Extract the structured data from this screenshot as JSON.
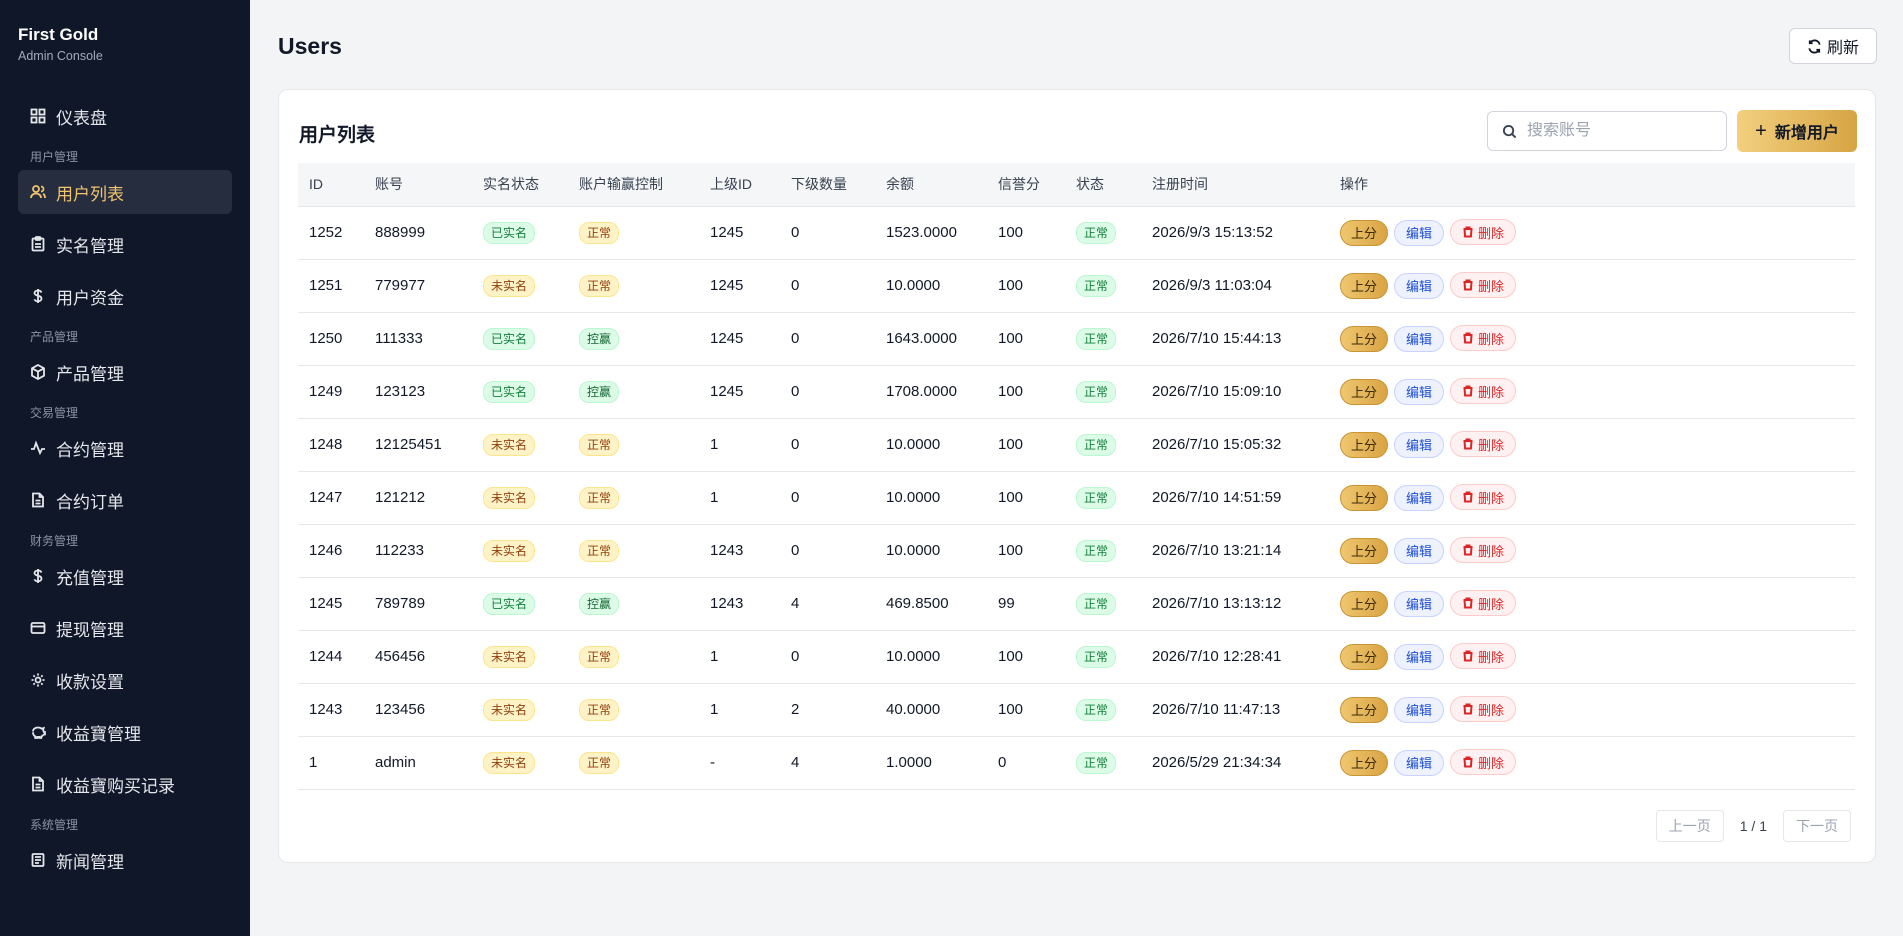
{
  "brand": {
    "title": "First Gold",
    "subtitle": "Admin Console"
  },
  "sidebar": {
    "dashboard": "仪表盘",
    "sec_user": "用户管理",
    "users": "用户列表",
    "realname": "实名管理",
    "funds": "用户资金",
    "sec_product": "产品管理",
    "products": "产品管理",
    "sec_trade": "交易管理",
    "contracts": "合约管理",
    "orders": "合约订单",
    "sec_finance": "财务管理",
    "recharge": "充值管理",
    "withdraw": "提现管理",
    "payment": "收款设置",
    "yield": "收益寶管理",
    "yield_records": "收益寶购买记录",
    "sec_system": "系统管理",
    "news": "新闻管理"
  },
  "header": {
    "title": "Users",
    "refresh": "刷新"
  },
  "card": {
    "title": "用户列表",
    "search_placeholder": "搜索账号",
    "add_label": "新增用户"
  },
  "table": {
    "columns": [
      "ID",
      "账号",
      "实名状态",
      "账户输赢控制",
      "上级ID",
      "下级数量",
      "余额",
      "信誉分",
      "状态",
      "注册时间",
      "操作"
    ],
    "actions": {
      "up": "上分",
      "edit": "编辑",
      "delete": "删除"
    },
    "rows": [
      {
        "id": "1252",
        "account": "888999",
        "realname": "已实名",
        "control": "正常",
        "parent": "1245",
        "children": "0",
        "balance": "1523.0000",
        "credit": "100",
        "status": "正常",
        "registered": "2026/9/3 15:13:52"
      },
      {
        "id": "1251",
        "account": "779977",
        "realname": "未实名",
        "control": "正常",
        "parent": "1245",
        "children": "0",
        "balance": "10.0000",
        "credit": "100",
        "status": "正常",
        "registered": "2026/9/3 11:03:04"
      },
      {
        "id": "1250",
        "account": "111333",
        "realname": "已实名",
        "control": "控赢",
        "parent": "1245",
        "children": "0",
        "balance": "1643.0000",
        "credit": "100",
        "status": "正常",
        "registered": "2026/7/10 15:44:13"
      },
      {
        "id": "1249",
        "account": "123123",
        "realname": "已实名",
        "control": "控赢",
        "parent": "1245",
        "children": "0",
        "balance": "1708.0000",
        "credit": "100",
        "status": "正常",
        "registered": "2026/7/10 15:09:10"
      },
      {
        "id": "1248",
        "account": "12125451",
        "realname": "未实名",
        "control": "正常",
        "parent": "1",
        "children": "0",
        "balance": "10.0000",
        "credit": "100",
        "status": "正常",
        "registered": "2026/7/10 15:05:32"
      },
      {
        "id": "1247",
        "account": "121212",
        "realname": "未实名",
        "control": "正常",
        "parent": "1",
        "children": "0",
        "balance": "10.0000",
        "credit": "100",
        "status": "正常",
        "registered": "2026/7/10 14:51:59"
      },
      {
        "id": "1246",
        "account": "112233",
        "realname": "未实名",
        "control": "正常",
        "parent": "1243",
        "children": "0",
        "balance": "10.0000",
        "credit": "100",
        "status": "正常",
        "registered": "2026/7/10 13:21:14"
      },
      {
        "id": "1245",
        "account": "789789",
        "realname": "已实名",
        "control": "控赢",
        "parent": "1243",
        "children": "4",
        "balance": "469.8500",
        "credit": "99",
        "status": "正常",
        "registered": "2026/7/10 13:13:12"
      },
      {
        "id": "1244",
        "account": "456456",
        "realname": "未实名",
        "control": "正常",
        "parent": "1",
        "children": "0",
        "balance": "10.0000",
        "credit": "100",
        "status": "正常",
        "registered": "2026/7/10 12:28:41"
      },
      {
        "id": "1243",
        "account": "123456",
        "realname": "未实名",
        "control": "正常",
        "parent": "1",
        "children": "2",
        "balance": "40.0000",
        "credit": "100",
        "status": "正常",
        "registered": "2026/7/10 11:47:13"
      },
      {
        "id": "1",
        "account": "admin",
        "realname": "未实名",
        "control": "正常",
        "parent": "-",
        "children": "4",
        "balance": "1.0000",
        "credit": "0",
        "status": "正常",
        "registered": "2026/5/29 21:34:34"
      }
    ]
  },
  "pager": {
    "prev": "上一页",
    "info": "1 / 1",
    "next": "下一页"
  }
}
